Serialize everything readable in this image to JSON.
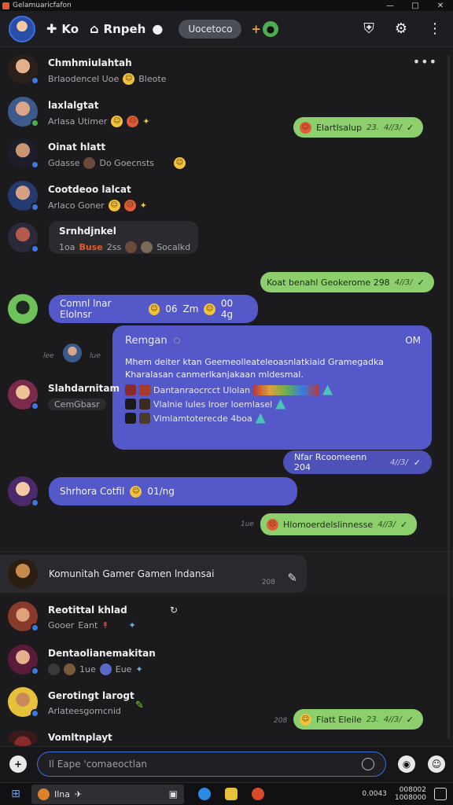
{
  "window": {
    "title": "Gelamuaricfafon",
    "controls": [
      "—",
      "□",
      "✕"
    ]
  },
  "header": {
    "nav_1": "Ko",
    "nav_2": "Rnpeh",
    "pill": "Uocetoco",
    "icons": [
      "shield-icon",
      "gear-icon",
      "more-vertical-icon"
    ]
  },
  "contacts": [
    {
      "name": "Chmhmiulahtah",
      "sub": "Brlaodencel Uoe",
      "sub2": "Bleote"
    },
    {
      "name": "laxlalgtat",
      "sub": "Arlasa Utimer"
    },
    {
      "name": "Oinat hlatt",
      "sub": "Gdasse",
      "sub2": "Do Goecnsts"
    },
    {
      "name": "Cootdeoo lalcat",
      "sub": "Arlaco Goner"
    },
    {
      "name": "Srnhdjnkel",
      "sub": "1oa",
      "tag": "Buse",
      "sub2": "2ss",
      "sub3": "Socalkd"
    }
  ],
  "messages": {
    "green_1": {
      "text": "Elartlsalup",
      "time": "23.",
      "time2": "4//3/"
    },
    "green_2": {
      "text": "Koat benahl Geokerome 298",
      "time": "4//3/"
    },
    "purple_1": {
      "text": "Comnl lnar Elolnsr",
      "num": "06",
      "tag": "Zm",
      "end": "00 4g"
    },
    "stamp_1": "lee",
    "stamp_2": "lue",
    "green_3": {
      "text": "Nfar Rcoomeenn 204",
      "time": "4//3/"
    },
    "purple_2": {
      "text": "Shrhora Cotfil",
      "end": "01/ng"
    },
    "green_4": {
      "text": "Hlomoerdelslinnesse",
      "time": "4//3/"
    },
    "stamp_3": "1ue"
  },
  "sender_card": {
    "name": "Slahdarnitam",
    "sub": "CemGbasr"
  },
  "card": {
    "title": "Remgan",
    "online": "OM",
    "body": "Mhem deiter ktan Geemeolleateleoasnlatkiaid Gramegadka Kharalasan canmerlkanjakaan mldesmal.",
    "rows": [
      "Dantanraocrcct Ulolan",
      "Vlalnie lules lroer loemlasel",
      "Vlmlamtoterecde 4boa"
    ]
  },
  "group": {
    "name": "Komunitah Gamer Gamen lndansai",
    "stamp": "208"
  },
  "list": [
    {
      "name": "Reotittal khlad",
      "sub": "Gooer",
      "sub2": "Eant"
    },
    {
      "name": "Dentaolianemakitan",
      "sub": "1ue",
      "sub2": "Eue"
    },
    {
      "name": "Gerotingt larogt",
      "sub": "Arlateesgomcnid"
    },
    {
      "name": "Vomltnplayt"
    }
  ],
  "messages_bottom": {
    "green_5": {
      "text": "Flatt Eleile",
      "time": "23.",
      "time2": "4//3/"
    },
    "stamp_4": "208"
  },
  "composer": {
    "placeholder": "Il Eape 'comaeoctlan"
  },
  "taskbar": {
    "search": "Ilna",
    "time": "0.0043",
    "date_1": "008002",
    "date_2": "1008000"
  }
}
